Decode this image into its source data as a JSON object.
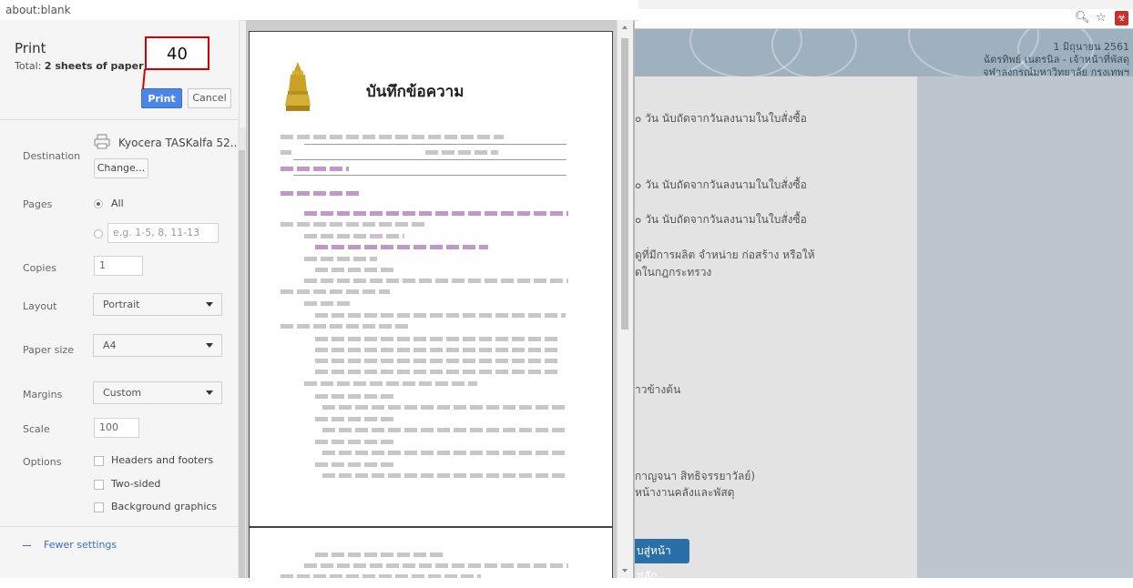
{
  "window": {
    "title": "about:blank"
  },
  "print": {
    "heading": "Print",
    "total_prefix": "Total: ",
    "total_value": "2 sheets of paper",
    "print_label": "Print",
    "cancel_label": "Cancel",
    "annotation": "40"
  },
  "destination": {
    "label": "Destination",
    "printer": "Kyocera TASKalfa 52...",
    "change_label": "Change..."
  },
  "pages": {
    "label": "Pages",
    "all_label": "All",
    "range_placeholder": "e.g. 1-5, 8, 11-13"
  },
  "copies": {
    "label": "Copies",
    "value": "1"
  },
  "layout": {
    "label": "Layout",
    "value": "Portrait"
  },
  "paper_size": {
    "label": "Paper size",
    "value": "A4"
  },
  "margins": {
    "label": "Margins",
    "value": "Custom"
  },
  "scale": {
    "label": "Scale",
    "value": "100"
  },
  "options": {
    "label": "Options",
    "headers_footers": "Headers and footers",
    "two_sided": "Two-sided",
    "background_graphics": "Background graphics"
  },
  "fewer_settings": "Fewer settings",
  "preview": {
    "memo_title": "บันทึกข้อความ"
  },
  "background_page": {
    "date": "1 มิถุนายน 2561",
    "name_line": "ฉัตรทิพย์ เนตรนิล - เจ้าหน้าที่พัสดุ",
    "org_line": "จุฬาลงกรณ์มหาวิทยาลัย กรุงเทพฯ",
    "lines": [
      "๐ วัน นับถัดจากวันลงนามในใบสั่งซื้อ",
      "๐ วัน นับถัดจากวันลงนามในใบสั่งซื้อ",
      "๐ วัน นับถัดจากวันลงนามในใบสั่งซื้อ",
      "ดูที่มีการผลิต จำหน่าย ก่อสร้าง หรือให้",
      "ดในกฎกระทรวง",
      "าวข้างต้น",
      "กาญจนา สิทธิจรรยาวัลย์)",
      "หน้างานคลังและพัสดุ"
    ],
    "home_button": "บสู่หน้าหลัก"
  },
  "colors": {
    "accent": "#4a86e8",
    "annotation_border": "#d40000",
    "pdf_icon": "#c9302c",
    "home_button": "#2b6fa8"
  },
  "icons": [
    "printer-icon",
    "zoom-icon",
    "star-icon",
    "pdf-icon"
  ]
}
